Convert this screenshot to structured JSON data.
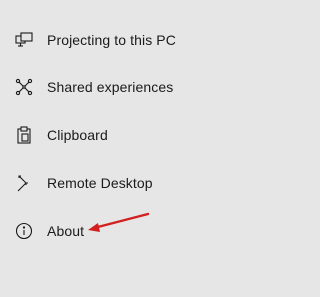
{
  "nav": {
    "items": [
      {
        "label": "Projecting to this PC",
        "icon": "projecting-icon"
      },
      {
        "label": "Shared experiences",
        "icon": "shared-experiences-icon"
      },
      {
        "label": "Clipboard",
        "icon": "clipboard-icon"
      },
      {
        "label": "Remote Desktop",
        "icon": "remote-desktop-icon"
      },
      {
        "label": "About",
        "icon": "info-icon"
      }
    ]
  },
  "annotation": {
    "arrow_color": "#d21f1f",
    "arrow_target": "About"
  }
}
